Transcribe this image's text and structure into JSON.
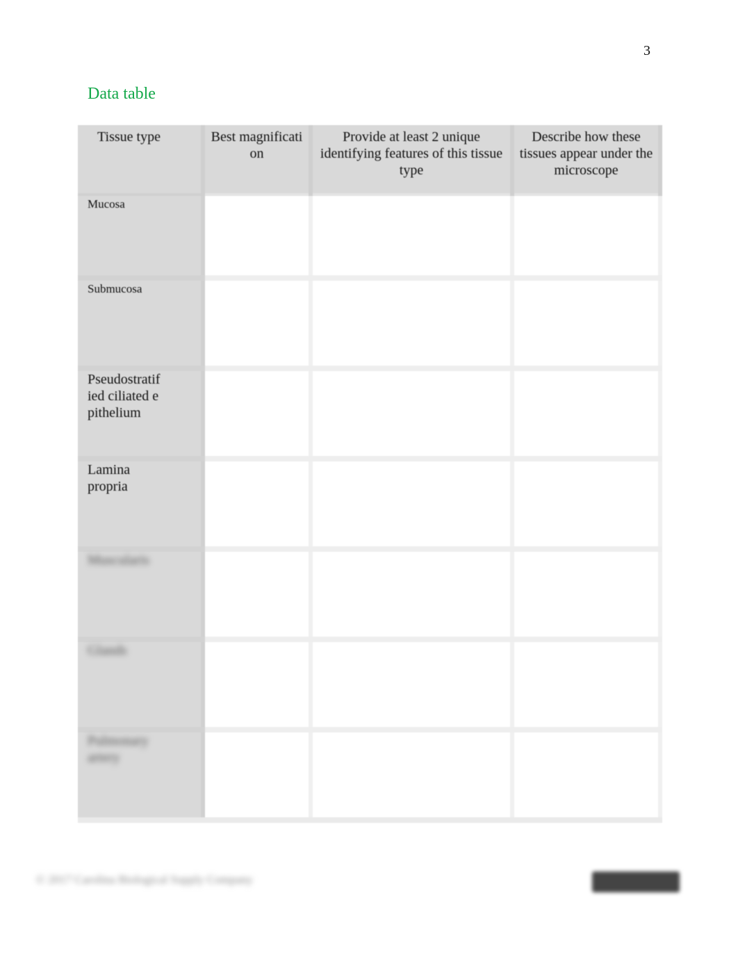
{
  "page": {
    "number": "3"
  },
  "section": {
    "title": "Data table"
  },
  "table": {
    "headers": [
      "Tissue type",
      "Best magnificati on",
      "Provide at least 2 unique identifying features of this tissue type",
      "Describe how these tissues appear under the microscope"
    ],
    "rows": [
      {
        "label": "Mucosa",
        "obscured": false
      },
      {
        "label": "Submucosa",
        "obscured": false
      },
      {
        "label": "Pseudostratified ciliated epithelium",
        "obscured": false
      },
      {
        "label": "Lamina propria",
        "obscured": false
      },
      {
        "label": "Muscularis",
        "obscured": true
      },
      {
        "label": "Glands",
        "obscured": true
      },
      {
        "label": "Pulmonary artery",
        "obscured": true
      }
    ]
  },
  "footer": {
    "copyright": "© 2017 Carolina Biological Supply Company"
  }
}
